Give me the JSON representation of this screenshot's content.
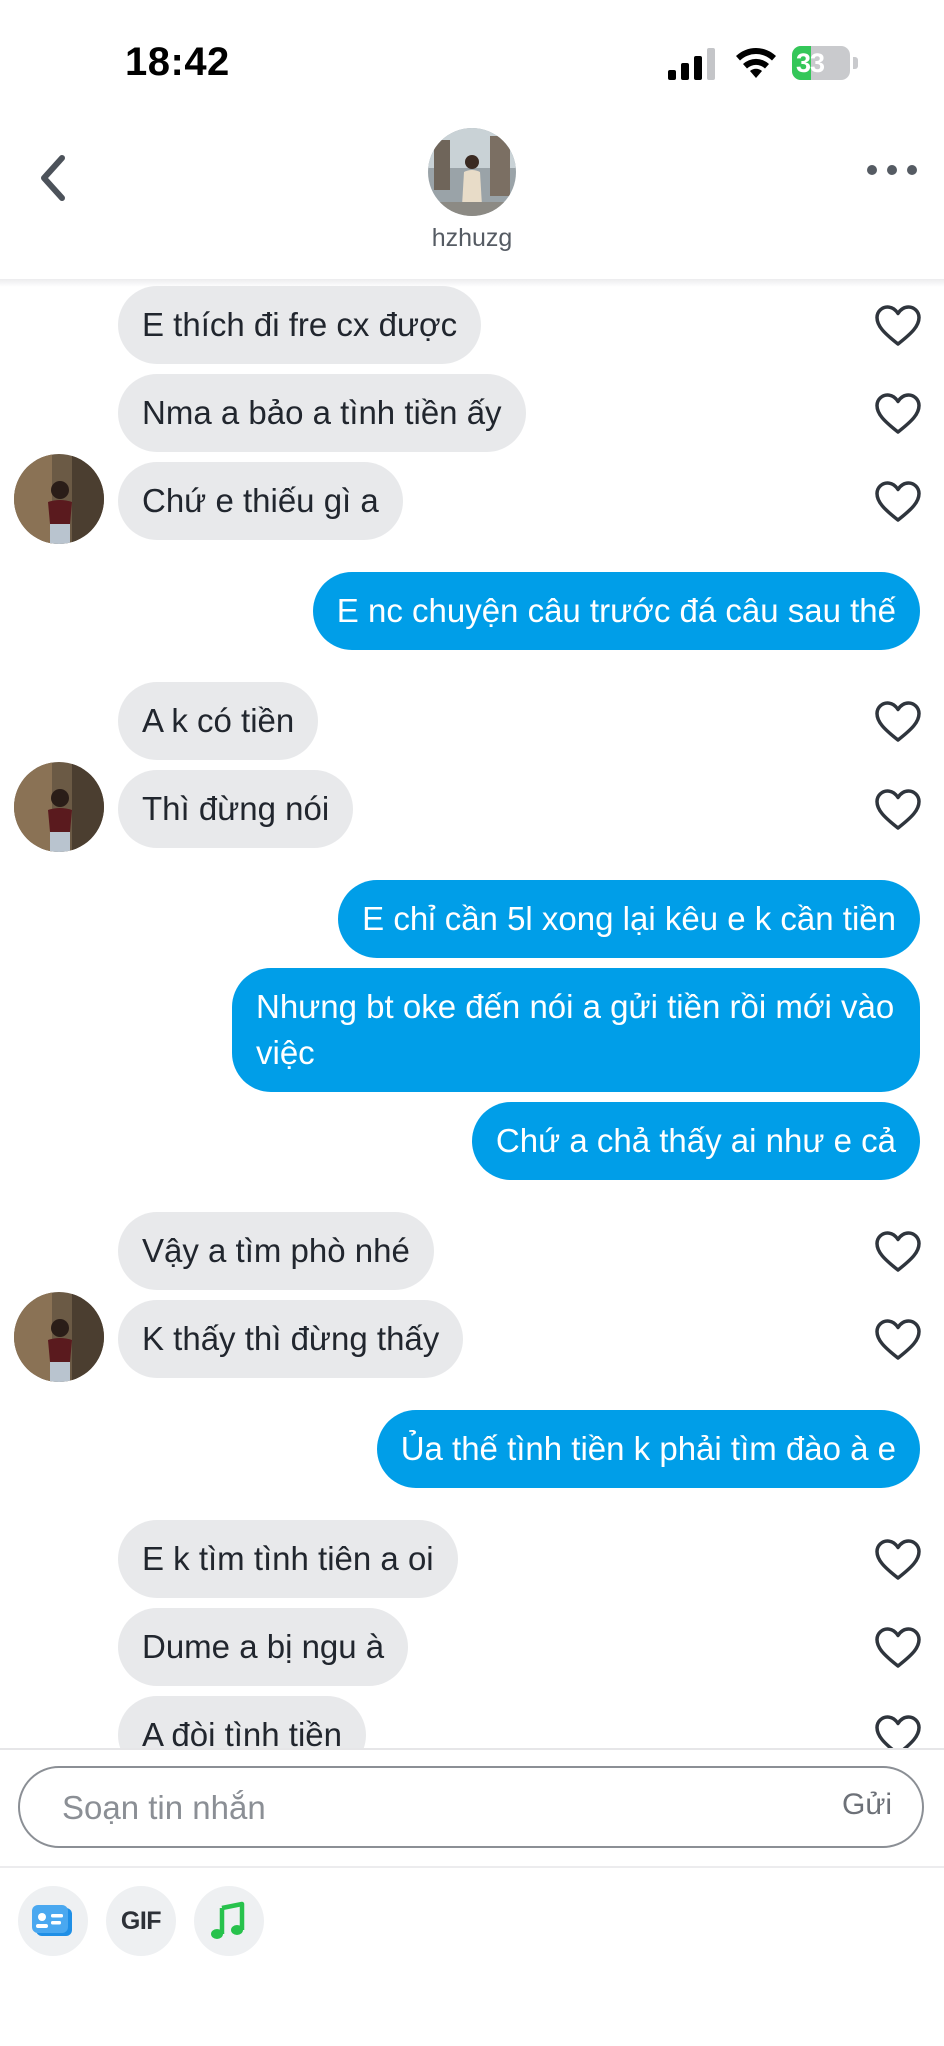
{
  "status_bar": {
    "time": "18:42",
    "battery": "33",
    "battery_level": 0.33
  },
  "header": {
    "username": "hzhuzg"
  },
  "messages": [
    {
      "from": "them",
      "text": "E thích đi fre cx được"
    },
    {
      "from": "them",
      "text": "Nma a bảo a tình tiền ấy"
    },
    {
      "from": "them",
      "text": "Chứ e thiếu gì a"
    },
    {
      "from": "me",
      "text": "E nc chuyện câu trước đá câu sau thế"
    },
    {
      "from": "them",
      "text": "A k có tiền"
    },
    {
      "from": "them",
      "text": "Thì đừng nói"
    },
    {
      "from": "me",
      "text": "E chỉ cần 5l xong lại kêu e k cần tiền"
    },
    {
      "from": "me",
      "text": "Nhưng bt oke đến nói a gửi tiền rồi mới vào việc"
    },
    {
      "from": "me",
      "text": "Chứ a chả thấy ai như e cả"
    },
    {
      "from": "them",
      "text": "Vậy a tìm phò nhé"
    },
    {
      "from": "them",
      "text": "K thấy thì đừng thấy"
    },
    {
      "from": "me",
      "text": "Ủa thế tình tiền k phải tìm đào à e"
    },
    {
      "from": "them",
      "text": "E k tìm tình tiên a oi"
    },
    {
      "from": "them",
      "text": "Dume a bị ngu à"
    },
    {
      "from": "them",
      "text": "A đòi tình tiền"
    }
  ],
  "composer": {
    "placeholder": "Soạn tin nhắn",
    "send_label": "Gửi",
    "gif_label": "GIF"
  },
  "colors": {
    "sent_bubble": "#009ee8",
    "received_bubble": "#e8e9eb",
    "heart": "#2f353d"
  },
  "icons": [
    "chevron-left-icon",
    "more-dots-icon",
    "heart-outline-icon",
    "contact-card-icon",
    "music-note-icon"
  ]
}
